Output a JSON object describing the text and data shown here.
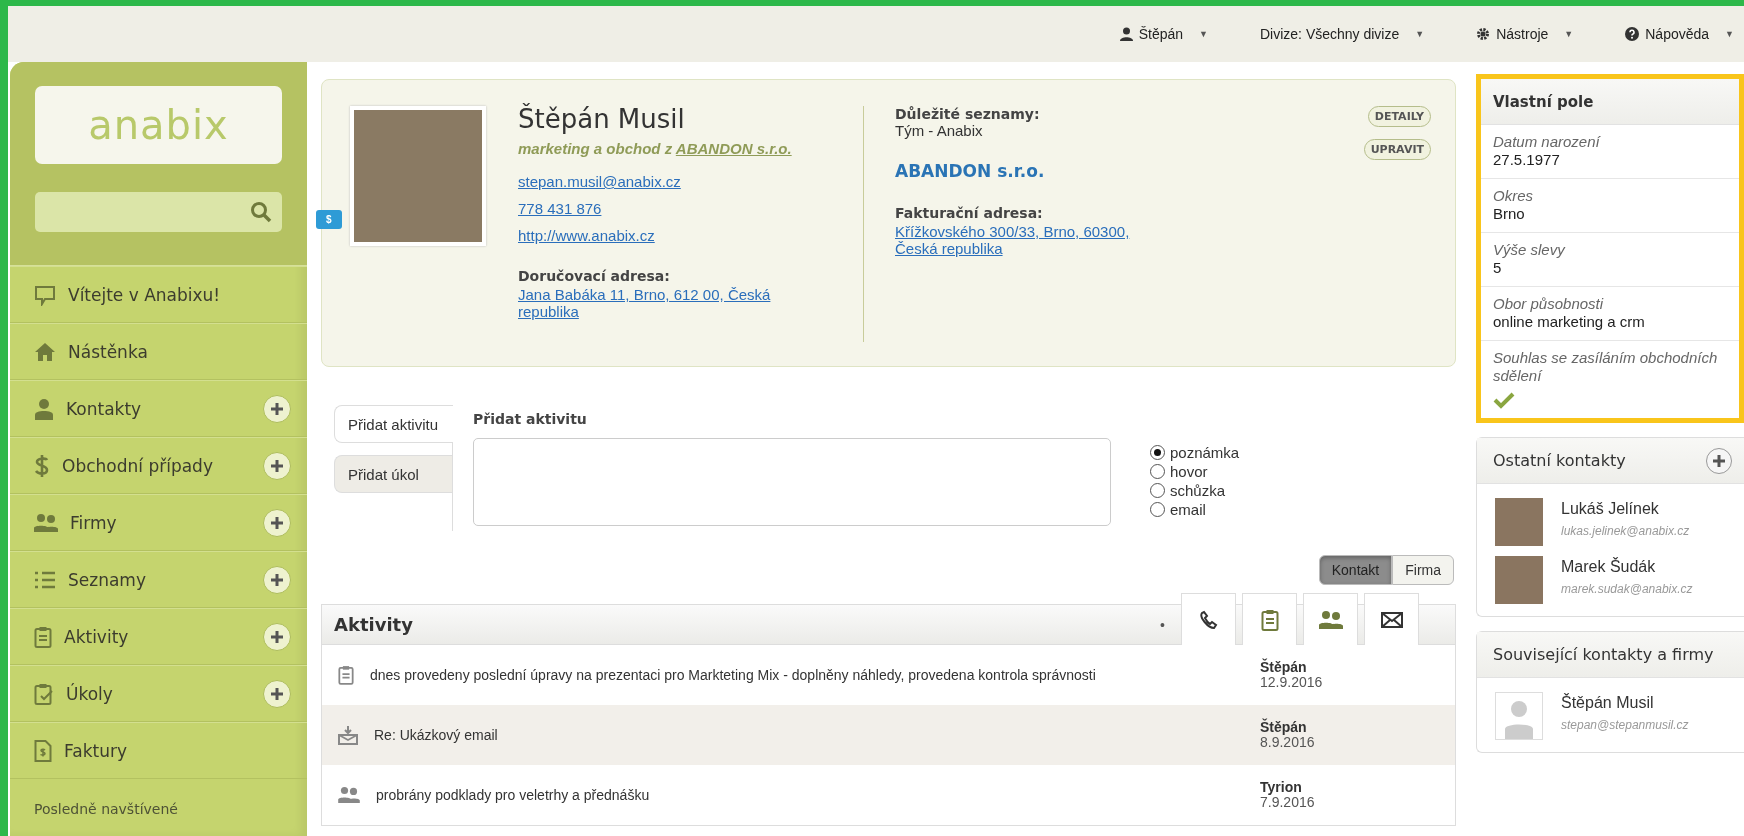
{
  "top_nav": [
    {
      "label": "Štěpán",
      "caret": "▼"
    },
    {
      "label": "Divize: Všechny divize",
      "caret": "▼"
    },
    {
      "label": "Nástroje",
      "caret": "▼"
    },
    {
      "label": "Nápověda",
      "caret": "▼"
    }
  ],
  "frame": {
    "highlighted": true
  },
  "sidebar": {
    "logo": "anabix",
    "items": [
      {
        "label": "Vítejte v Anabixu!",
        "add_button": false
      },
      {
        "label": "Nástěnka",
        "add_button": false
      },
      {
        "label": "Kontakty",
        "add_button": true
      },
      {
        "label": "Obchodní případy",
        "add_button": true
      },
      {
        "label": "Firmy",
        "add_button": true
      },
      {
        "label": "Seznamy",
        "add_button": true
      },
      {
        "label": "Aktivity",
        "add_button": true
      },
      {
        "label": "Úkoly",
        "add_button": true
      },
      {
        "label": "Faktury",
        "add_button": false
      }
    ],
    "section_label": "Posledně navštívené"
  },
  "contact": {
    "badge": "$",
    "name": "Štěpán Musil",
    "subtitle": "marketing a obchod z ",
    "company_link": "ABANDON s.r.o.",
    "email": "stepan.musil@anabix.cz",
    "phone": "778 431 876",
    "web": "http://www.anabix.cz",
    "delivery_label": "Doručovací adresa:",
    "delivery_address": "Jana Babáka 11, Brno, 612 00, Česká republika",
    "lists_label": "Důležité seznamy:",
    "lists_value": "Tým - Anabix",
    "company": "ABANDON s.r.o.",
    "billing_label": "Fakturační adresa:",
    "billing_address": "Křížkovského 300/33, Brno, 60300, Česká republika",
    "buttons": [
      "DETAILY",
      "UPRAVIT"
    ]
  },
  "activity_form": {
    "tabs": [
      {
        "label": "Přidat aktivitu",
        "selected": true
      },
      {
        "label": "Přidat úkol",
        "selected": false
      }
    ],
    "title": "Přidat aktivitu",
    "types": [
      {
        "label": "poznámka",
        "selected": true
      },
      {
        "label": "hovor",
        "selected": false
      },
      {
        "label": "schůzka",
        "selected": false
      },
      {
        "label": "email",
        "selected": false
      }
    ]
  },
  "scope_toggle": [
    {
      "label": "Kontakt",
      "selected": true
    },
    {
      "label": "Firma",
      "selected": false
    }
  ],
  "activities": {
    "title": "Aktivity",
    "dot": "•",
    "rows": [
      {
        "kind": "note",
        "text": "dnes provedeny poslední úpravy na prezentaci pro Markteting Mix - doplněny náhledy, provedena kontrola správnosti",
        "author": "Štěpán",
        "date": "12.9.2016"
      },
      {
        "kind": "email",
        "text": "Re: Ukázkový email",
        "author": "Štěpán",
        "date": "8.9.2016"
      },
      {
        "kind": "meeting",
        "text": "probrány podklady pro veletrhy a přednášku",
        "author": "Tyrion",
        "date": "7.9.2016"
      }
    ]
  },
  "custom_fields": {
    "title": "Vlastní pole",
    "fields": [
      {
        "kind": "text",
        "label": "Datum narození",
        "value": "27.5.1977"
      },
      {
        "kind": "text",
        "label": "Okres",
        "value": "Brno"
      },
      {
        "kind": "text",
        "label": "Výše slevy",
        "value": "5"
      },
      {
        "kind": "text",
        "label": "Obor působnosti",
        "value": "online marketing a crm"
      },
      {
        "kind": "check",
        "label": "Souhlas se zasíláním obchodních sdělení",
        "checked": true
      }
    ]
  },
  "other_contacts": {
    "title": "Ostatní kontakty",
    "contacts": [
      {
        "name": "Lukáš Jelínek",
        "email": "lukas.jelinek@anabix.cz"
      },
      {
        "name": "Marek Šudák",
        "email": "marek.sudak@anabix.cz"
      }
    ]
  },
  "related": {
    "title": "Související kontakty a firmy",
    "contacts": [
      {
        "name": "Štěpán Musil",
        "email": "stepan@stepanmusil.cz"
      }
    ]
  }
}
